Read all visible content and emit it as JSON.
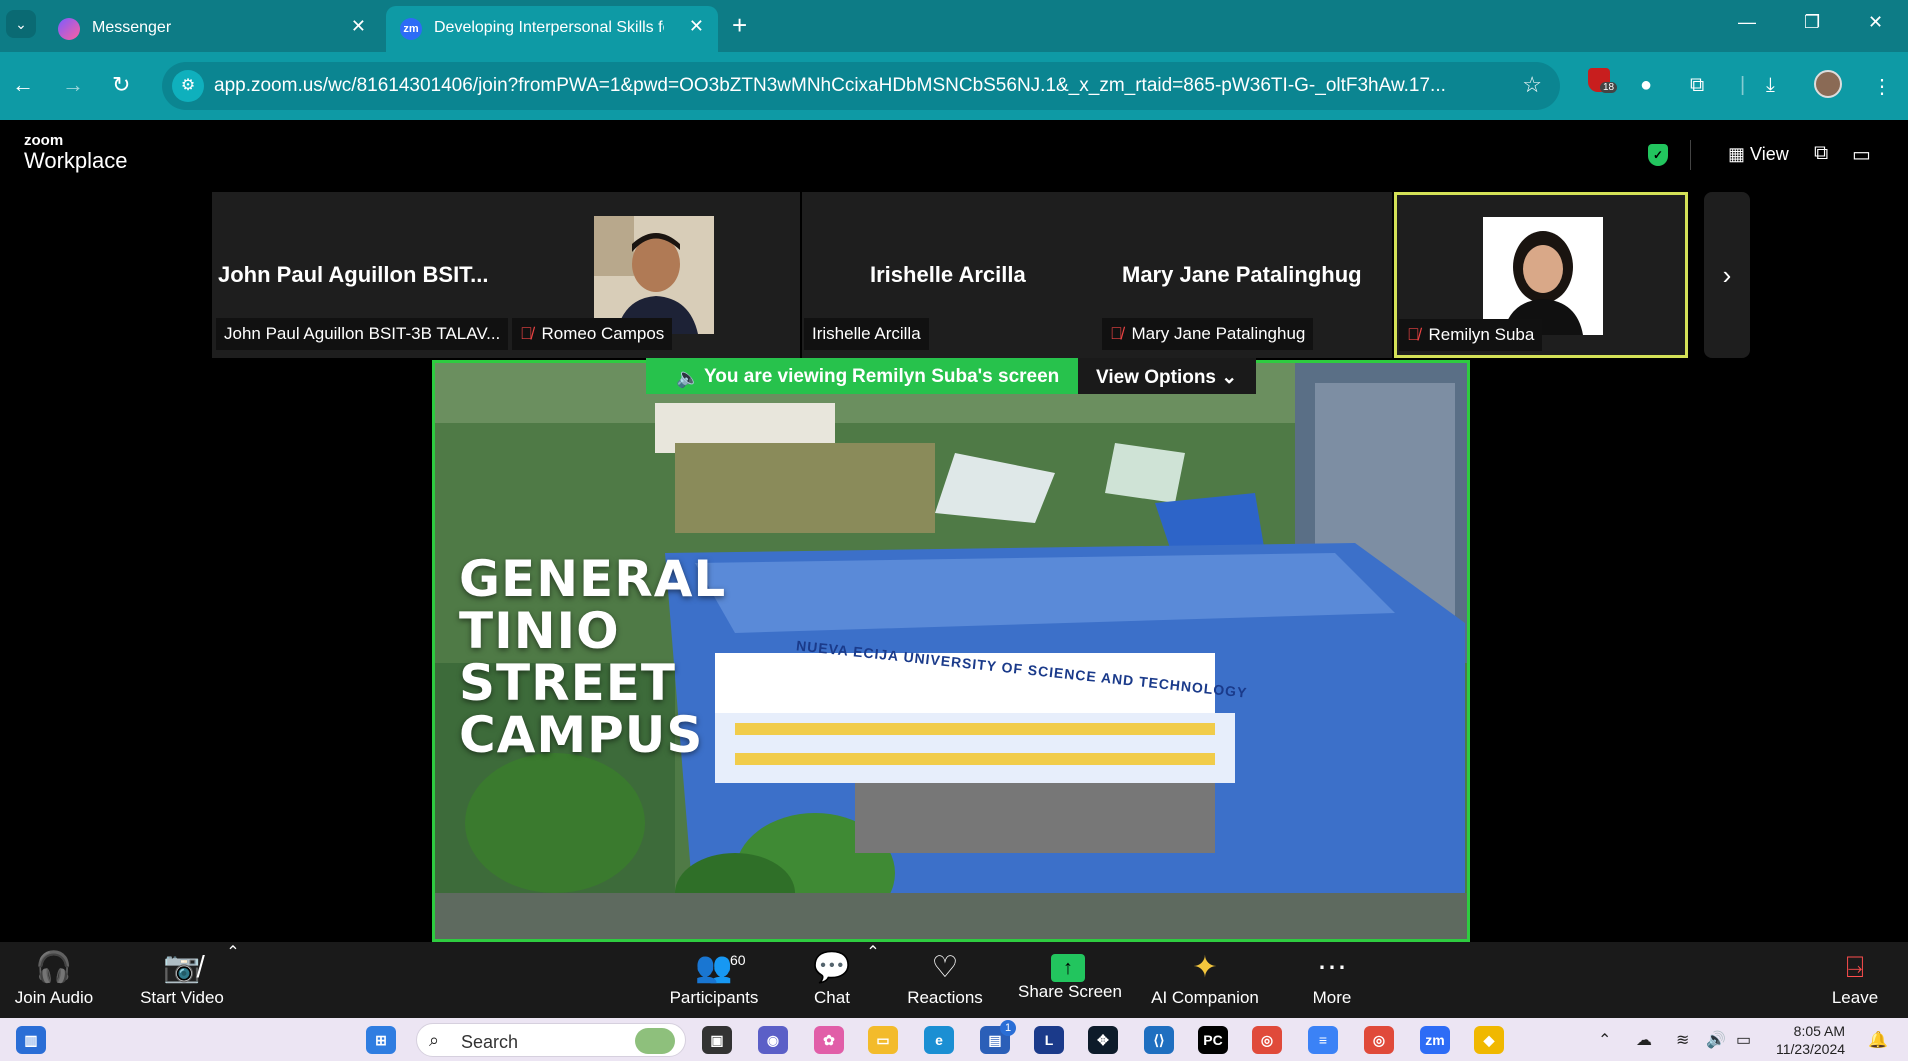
{
  "browser": {
    "tabs": [
      {
        "label": "Messenger",
        "active": false
      },
      {
        "label": "Developing Interpersonal Skills for",
        "active": true
      }
    ],
    "url": "app.zoom.us/wc/81614301406/join?fromPWA=1&pwd=OO3bZTN3wMNhCcixaHDbMSNCbS56NJ.1&_x_zm_rtaid=865-pW36TI-G-_oltF3hAw.17...",
    "extension_badge": "18"
  },
  "zoom": {
    "brand_small": "zoom",
    "brand_big": "Workplace",
    "view_label": "View"
  },
  "participants": [
    {
      "big_name": "John Paul Aguillon BSIT...",
      "label": "John Paul Aguillon BSIT-3B TALAV...",
      "muted": false
    },
    {
      "label": "Romeo Campos",
      "muted": true
    },
    {
      "big_name": "Irishelle Arcilla",
      "label": "Irishelle Arcilla",
      "muted": false
    },
    {
      "big_name": "Mary Jane Patalinghug",
      "label": "Mary Jane Patalinghug",
      "muted": true
    },
    {
      "label": "Remilyn Suba",
      "muted": true,
      "active_speaker": true
    }
  ],
  "share": {
    "viewing_prefix": "You are viewing",
    "viewing_owner": "Remilyn Suba's screen",
    "view_options": "View Options",
    "campus_lines": [
      "GENERAL",
      "TINIO",
      "STREET",
      "CAMPUS"
    ],
    "building_sign": "NUEVA ECIJA UNIVERSITY OF SCIENCE AND TECHNOLOGY"
  },
  "controls": {
    "join_audio": "Join Audio",
    "start_video": "Start Video",
    "participants": "Participants",
    "participants_count": "60",
    "chat": "Chat",
    "reactions": "Reactions",
    "share_screen": "Share Screen",
    "ai_companion": "AI Companion",
    "more": "More",
    "leave": "Leave"
  },
  "taskbar": {
    "search": "Search",
    "time": "8:05 AM",
    "date": "11/23/2024",
    "store_badge": "1"
  },
  "colors": {
    "browser_tab_bar": "#0d7c86",
    "browser_toolbar": "#0e9aa5",
    "share_border": "#2ecc40",
    "active_speaker_border": "#d4e157",
    "muted_icon": "#ef4444"
  }
}
